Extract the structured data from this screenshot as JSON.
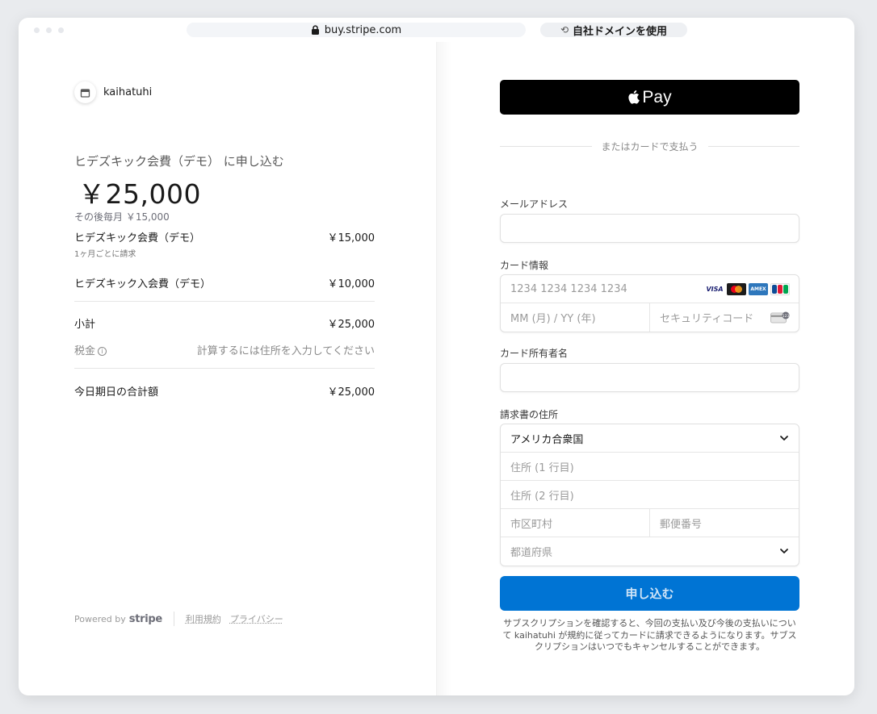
{
  "browser": {
    "url": "buy.stripe.com",
    "custom_domain_label": "自社ドメインを使用",
    "custom_domain_icon": "loop-arrows-icon"
  },
  "summary": {
    "merchant_name": "kaihatuhi",
    "product_line": "ヒデズキック会費（デモ） に申し込む",
    "price": "￥25,000",
    "then_monthly": "その後毎月 ￥15,000",
    "line_items": [
      {
        "name": "ヒデズキック会費（デモ）",
        "sub": "1ヶ月ごとに請求",
        "price": "￥15,000"
      },
      {
        "name": "ヒデズキック入会費（デモ）",
        "sub": "",
        "price": "￥10,000"
      }
    ],
    "subtotal_label": "小計",
    "subtotal_value": "￥25,000",
    "tax_label": "税金",
    "tax_value": "計算するには住所を入力してください",
    "total_label": "今日期日の合計額",
    "total_value": "￥25,000"
  },
  "footer": {
    "powered_by": "Powered by",
    "brand": "stripe",
    "terms": "利用規約",
    "privacy": "プライバシー"
  },
  "form": {
    "apple_pay_label": "Pay",
    "or_card": "またはカードで支払う",
    "email_label": "メールアドレス",
    "email_value": "",
    "card_label": "カード情報",
    "card_number_placeholder": "1234 1234 1234 1234",
    "card_brand_visa": "VISA",
    "card_brand_amex": "AMEX",
    "expiry_placeholder": "MM (月) / YY (年)",
    "cvc_placeholder": "セキュリティコード",
    "cardholder_label": "カード所有者名",
    "cardholder_value": "",
    "billing_label": "請求書の住所",
    "country_value": "アメリカ合衆国",
    "address1_placeholder": "住所 (1 行目)",
    "address2_placeholder": "住所 (2 行目)",
    "city_placeholder": "市区町村",
    "postal_placeholder": "郵便番号",
    "state_placeholder": "都道府県",
    "submit_label": "申し込む",
    "terms_text": "サブスクリプションを確認すると、今回の支払い及び今後の支払いについて kaihatuhi が規約に従ってカードに請求できるようになります。サブスクリプションはいつでもキャンセルすることができます。"
  },
  "colors": {
    "accent": "#0074d4",
    "apple_pay_bg": "#000000"
  }
}
